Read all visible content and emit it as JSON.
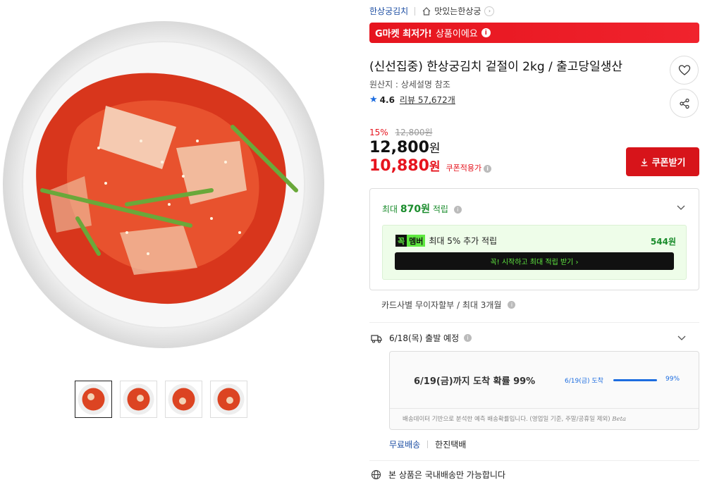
{
  "product_images": {
    "main_alt": "kimchi-plate",
    "thumbnail_count": 4
  },
  "breadcrumb": {
    "brand": "한상궁김치",
    "store": "맛있는한상궁"
  },
  "banner": {
    "bold": "G마켓 최저가!",
    "rest": "상품이에요",
    "info_glyph": "i"
  },
  "product": {
    "title": "(신선집중) 한상궁김치 겉절이 2kg / 출고당일생산",
    "origin": "원산지 : 상세설명 참조",
    "rating": "4.6",
    "review_label": "리뷰 57,672개"
  },
  "pricing": {
    "discount_pct": "15%",
    "original_price": "12,800원",
    "price_number": "12,800",
    "price_unit": "원",
    "coupon_price_number": "10,880",
    "coupon_price_unit": "원",
    "coupon_label": "쿠폰적용가",
    "coupon_button": "쿠폰받기"
  },
  "rewards": {
    "prefix": "최대",
    "amount": "870원",
    "suffix": "적립",
    "member_badge_k": "꼭",
    "member_badge_m": "멤버",
    "member_text": "최대 5% 추가 적립",
    "member_amount": "544원",
    "member_cta": "꼭! 시작하고 최대 적립 받기  ›"
  },
  "installment": "카드사별 무이자할부 / 최대 3개월",
  "shipping": {
    "departure": "6/18(목) 출발 예정",
    "probability_main": "6/19(금)까지 도착 확률 99%",
    "probability_date": "6/19(금) 도착",
    "probability_pct": "99%",
    "probability_value": 0.99,
    "note": "배송데이터 기반으로 분석한 예측 배송확률입니다. (영업일 기준, 주말/공휴일 제외)",
    "note_tag": "Beta",
    "free_label": "무료배송",
    "carrier": "한진택배",
    "domestic": "본 상품은 국내배송만 가능합니다"
  },
  "colors": {
    "accent_red": "#e6141e",
    "reward_green": "#1a8c2c",
    "member_green": "#5fe840",
    "link_blue": "#1d4ea3"
  },
  "icons": [
    "home-icon",
    "chevron-right-icon",
    "info-icon",
    "heart-icon",
    "share-icon",
    "star-icon",
    "download-icon",
    "chevron-down-icon",
    "truck-icon",
    "globe-icon"
  ]
}
